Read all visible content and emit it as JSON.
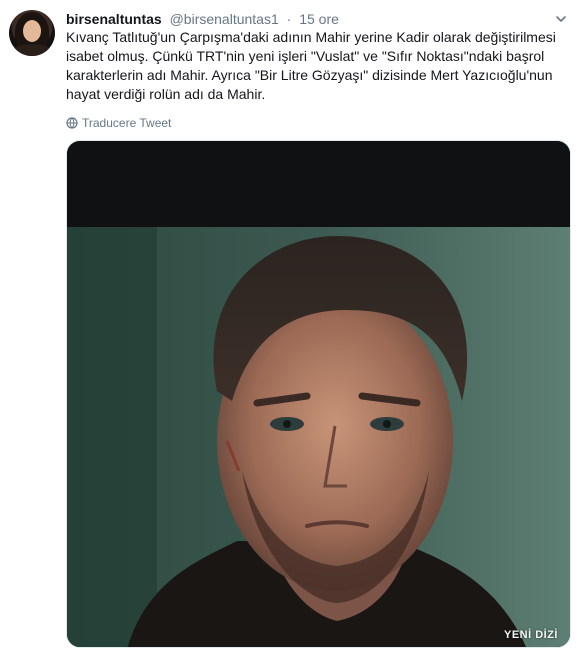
{
  "tweet": {
    "display_name": "birsenaltuntas",
    "handle": "@birsenaltuntas1",
    "separator": "·",
    "time": "15 ore",
    "text": "Kıvanç Tatlıtuğ'un Çarpışma'daki adının Mahir yerine Kadir olarak değiştirilmesi\nisabet olmuş. Çünkü TRT'nin yeni işleri \"Vuslat\" ve \"Sıfır Noktası\"ndaki başrol\nkarakterlerin adı Mahir. Ayrıca \"Bir Litre Gözyaşı\" dizisinde Mert Yazıcıoğlu'nun\nhayat verdiği rolün adı da Mahir.",
    "translate_label": "Traducere Tweet",
    "media_watermark": "YENİ DİZİ"
  },
  "icons": {
    "avatar": "profile-photo",
    "more": "chevron-down-icon",
    "translate": "globe-icon"
  },
  "colors": {
    "text": "#14171a",
    "secondary": "#657786",
    "border": "#e1e8ed"
  }
}
